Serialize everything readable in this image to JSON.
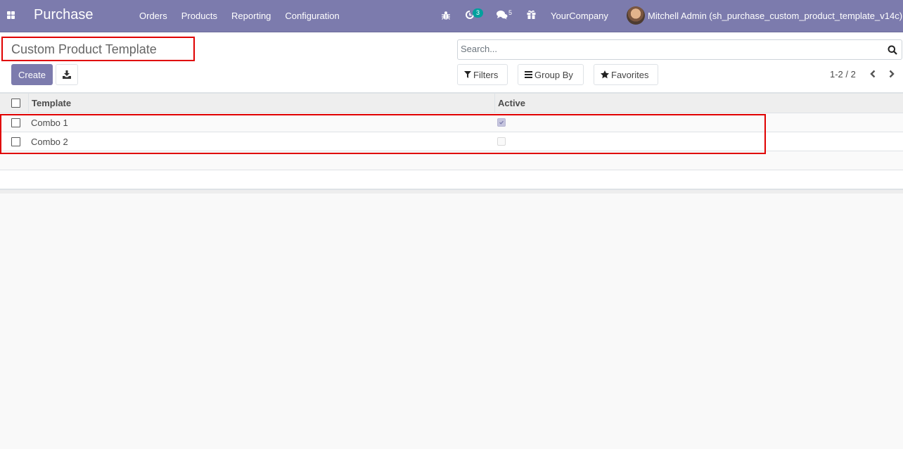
{
  "navbar": {
    "app_name": "Purchase",
    "menu": [
      "Orders",
      "Products",
      "Reporting",
      "Configuration"
    ],
    "activity_count": "3",
    "messages_count": "5",
    "company": "YourCompany",
    "user": "Mitchell Admin (sh_purchase_custom_product_template_v14c)",
    "brand_color": "#7c7bad",
    "badge_color": "#00a09d"
  },
  "control_panel": {
    "title": "Custom Product Template",
    "create_label": "Create",
    "search_placeholder": "Search...",
    "filters_label": "Filters",
    "groupby_label": "Group By",
    "favorites_label": "Favorites",
    "pager": "1-2 / 2"
  },
  "list": {
    "columns": [
      "Template",
      "Active"
    ],
    "rows": [
      {
        "template": "Combo 1",
        "active": true
      },
      {
        "template": "Combo 2",
        "active": false
      }
    ]
  },
  "annotation_color": "#e00000"
}
